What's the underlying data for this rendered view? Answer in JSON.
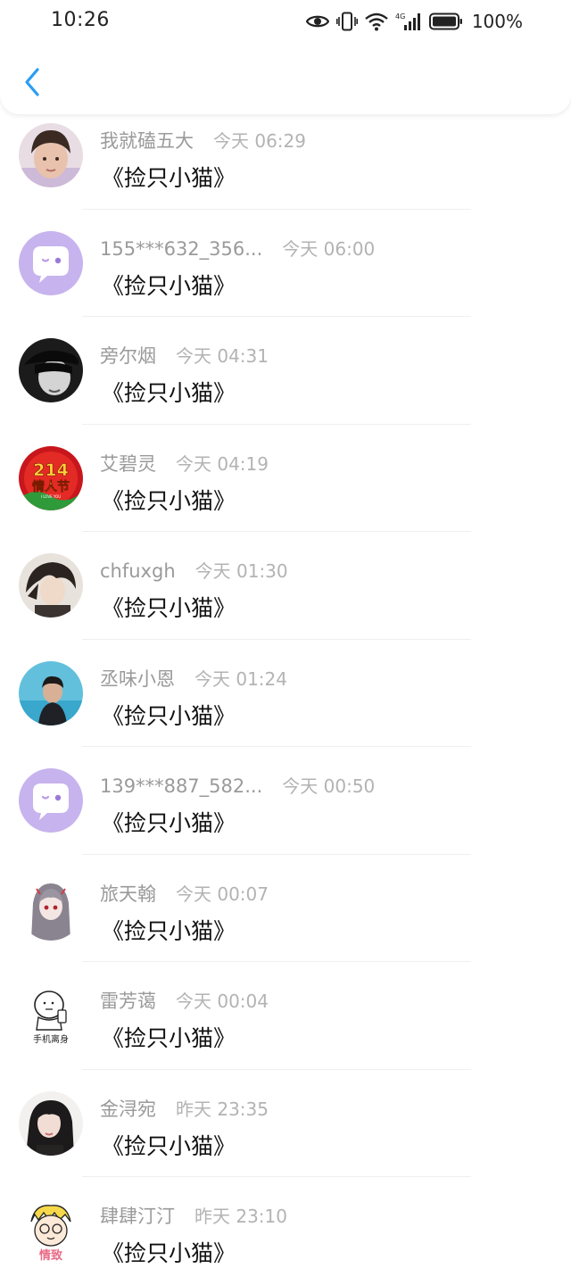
{
  "status_bar": {
    "time": "10:26",
    "network": "4G",
    "battery": "100%"
  },
  "header": {
    "back_icon": "chevron-left-icon",
    "accent_color": "#2a9df4"
  },
  "comments": [
    {
      "username": "我就磕五大",
      "time": "今天 06:29",
      "text": "《捡只小猫》"
    },
    {
      "username": "155***632_356...",
      "time": "今天 06:00",
      "text": "《捡只小猫》"
    },
    {
      "username": "旁尔烟",
      "time": "今天 04:31",
      "text": "《捡只小猫》"
    },
    {
      "username": "艾碧灵",
      "time": "今天 04:19",
      "text": "《捡只小猫》"
    },
    {
      "username": "chfuxgh",
      "time": "今天 01:30",
      "text": "《捡只小猫》"
    },
    {
      "username": "丞味小恩",
      "time": "今天 01:24",
      "text": "《捡只小猫》"
    },
    {
      "username": "139***887_582...",
      "time": "今天 00:50",
      "text": "《捡只小猫》"
    },
    {
      "username": "旅天翰",
      "time": "今天 00:07",
      "text": "《捡只小猫》"
    },
    {
      "username": "雷芳蔼",
      "time": "今天 00:04",
      "text": "《捡只小猫》"
    },
    {
      "username": "金浔宛",
      "time": "昨天 23:35",
      "text": "《捡只小猫》"
    },
    {
      "username": "肆肆汀汀",
      "time": "昨天 23:10",
      "text": "《捡只小猫》"
    }
  ],
  "avatar_badge": {
    "top": "214",
    "bottom": "情人节",
    "sub": "I LOVE YOU"
  },
  "avatar_caption": "手机离身",
  "avatar_stamp": "情致"
}
